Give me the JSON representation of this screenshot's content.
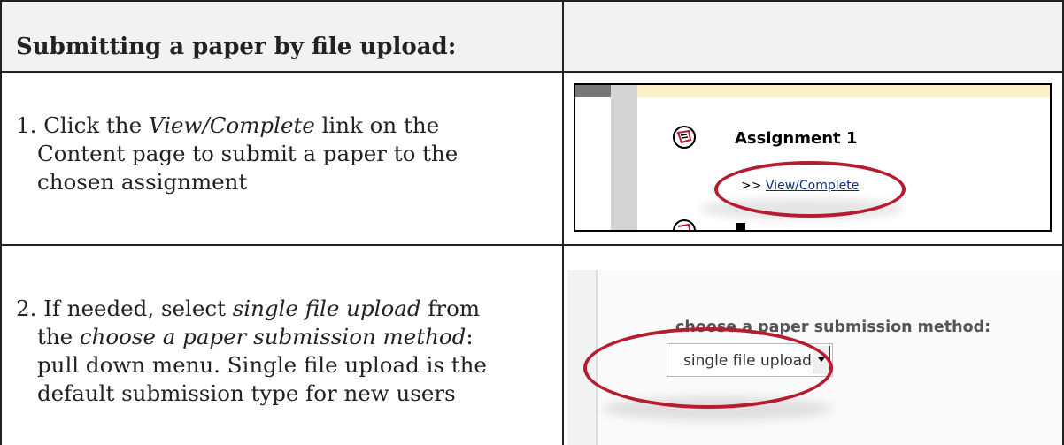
{
  "header": {
    "title": "Submitting a paper by file upload:"
  },
  "steps": [
    {
      "number": "1.",
      "lines": [
        [
          "Click the ",
          "View/Complete",
          " link on the"
        ],
        [
          "Content page to submit a paper to the"
        ],
        [
          "chosen assignment"
        ]
      ]
    },
    {
      "number": "2.",
      "lines": [
        [
          "If needed, select ",
          "single file upload",
          " from"
        ],
        [
          "the ",
          "choose a paper submission method",
          ":"
        ],
        [
          "pull down menu. Single file upload is the"
        ],
        [
          "default submission type for new users"
        ]
      ]
    }
  ],
  "screenshot1": {
    "assignment_title": "Assignment 1",
    "link_prefix": ">>",
    "link_label": "View/Complete",
    "icon": "assignment-icon",
    "highlight_color": "#b51c32",
    "topbar_color": "#fbf0c6"
  },
  "screenshot2": {
    "label": "choose a paper submission method:",
    "selected_value": "single file upload",
    "highlight_color": "#b51c32"
  }
}
